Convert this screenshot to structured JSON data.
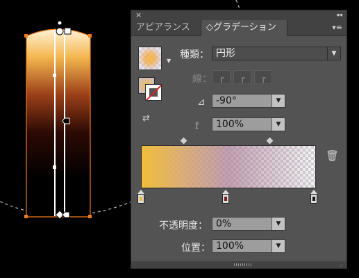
{
  "titlebar": {
    "close_icon": "×",
    "collapse_icon": "◂◂"
  },
  "tabs": [
    {
      "label": "アピアランス"
    },
    {
      "label": "◇グラデーション"
    }
  ],
  "panel_menu_icon": "▾≡",
  "gradient": {
    "type_label": "種類：",
    "type_value": "円形",
    "stroke_label": "線：",
    "angle_value": "-90°",
    "aspect_value": "100%",
    "opacity_label": "不透明度：",
    "opacity_value": "0%",
    "position_label": "位置：",
    "position_value": "100%"
  },
  "icons": {
    "dropdown": "▼",
    "thumb_arrow": "▼",
    "angle": "⊿",
    "aspect": "⟟",
    "trash": "🗑",
    "reverse": "⇄",
    "resize": "⋰"
  },
  "colors": {
    "stop_start": "#f4b43a",
    "stop_mid": "#7a1f1f",
    "stop_end": "#1a1a1a"
  }
}
